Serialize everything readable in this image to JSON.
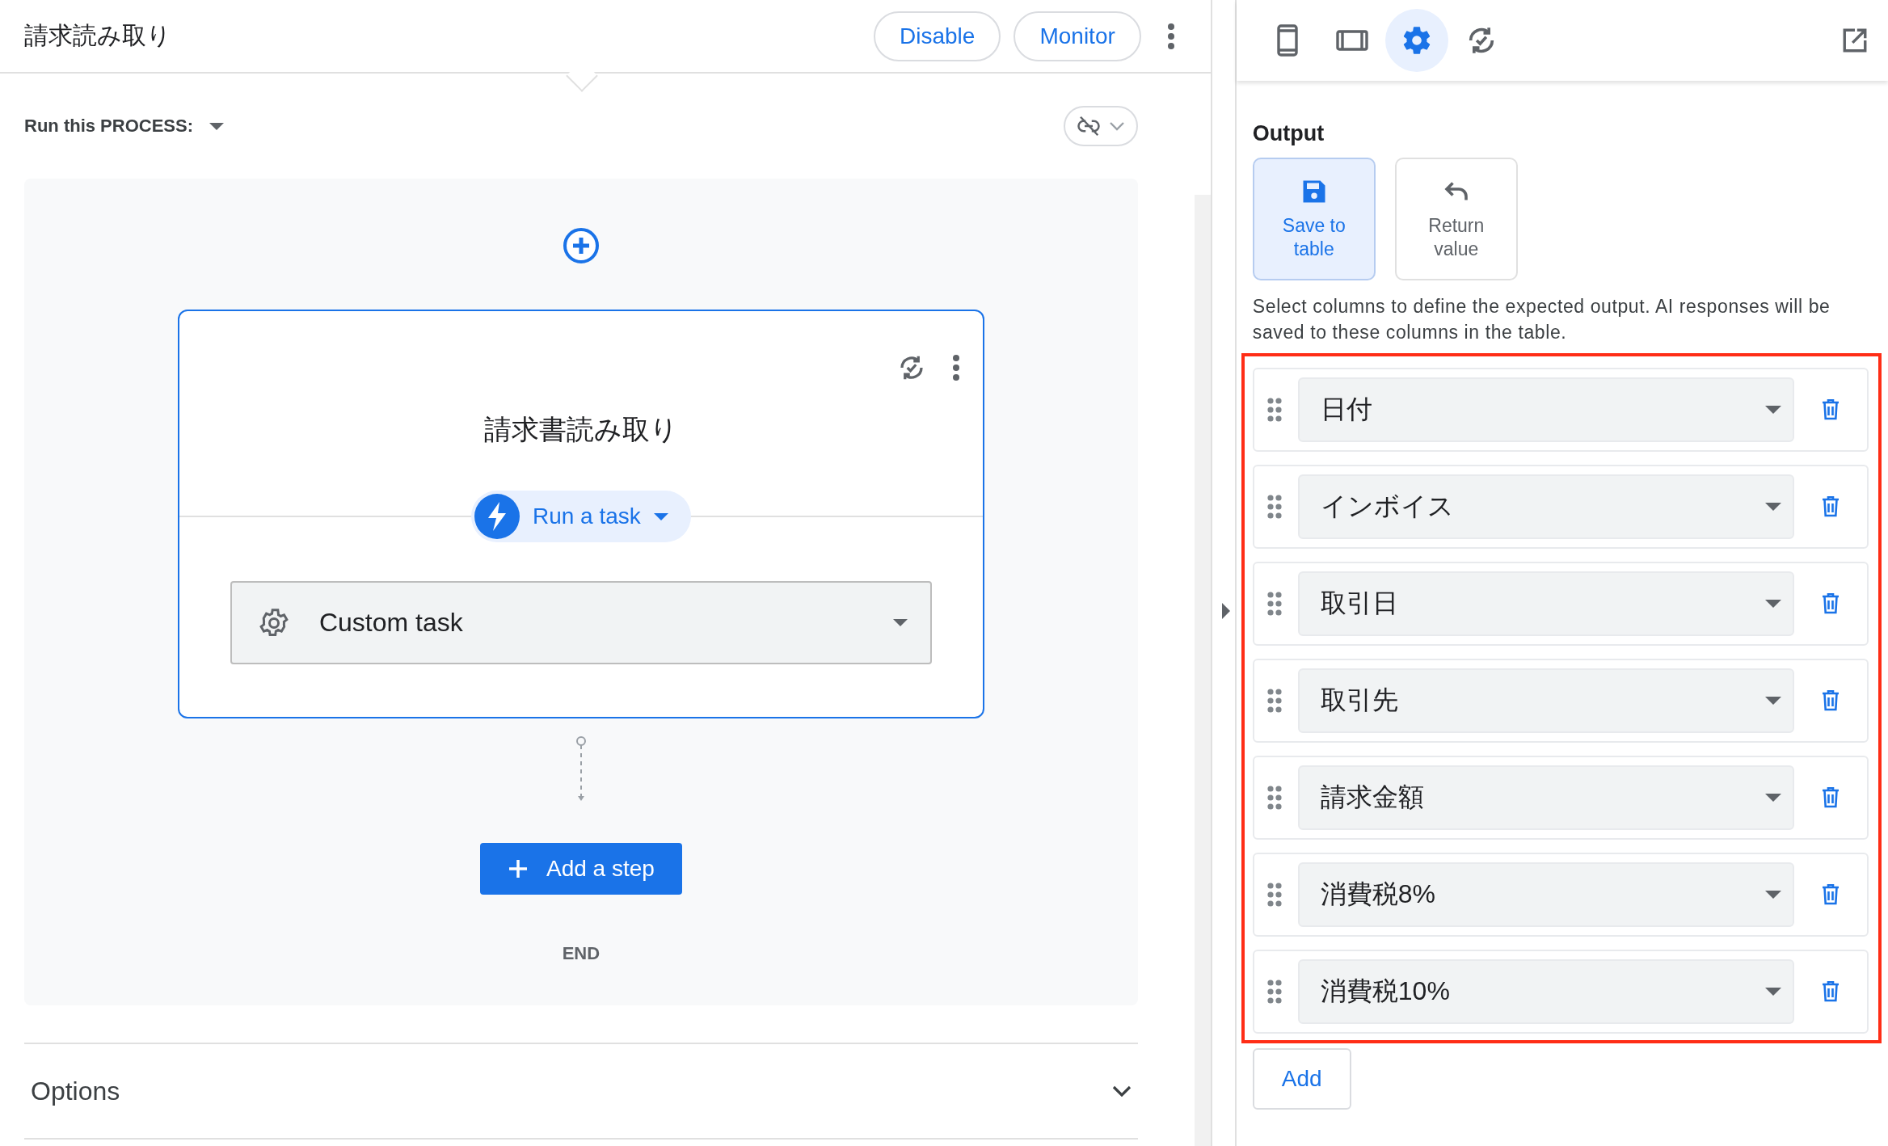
{
  "header": {
    "title": "請求読み取り",
    "buttons": [
      "Disable",
      "Monitor"
    ]
  },
  "link_toggle": {
    "linked": false
  },
  "flow": {
    "run_label": "Run this PROCESS:",
    "step": {
      "title": "請求書読み取り",
      "action": "Run a task",
      "task": "Custom task"
    },
    "add_step": "Add a step",
    "end": "END"
  },
  "options": {
    "label": "Options",
    "expanded": false
  },
  "side_panel": {
    "tabs": [
      {
        "kind": "phone",
        "selected": false
      },
      {
        "kind": "tablet",
        "selected": false
      },
      {
        "kind": "settings",
        "selected": true
      },
      {
        "kind": "sync",
        "selected": false
      }
    ],
    "output": {
      "heading": "Output",
      "choices": [
        {
          "kind": "save",
          "label": "Save to table",
          "selected": true
        },
        {
          "kind": "return",
          "label": "Return value",
          "selected": false
        }
      ],
      "description": "Select columns to define the expected output. AI responses will be saved to these columns in the table.",
      "columns": [
        "日付",
        "インボイス",
        "取引日",
        "取引先",
        "請求金額",
        "消費税8%",
        "消費税10%"
      ],
      "add": "Add"
    }
  }
}
